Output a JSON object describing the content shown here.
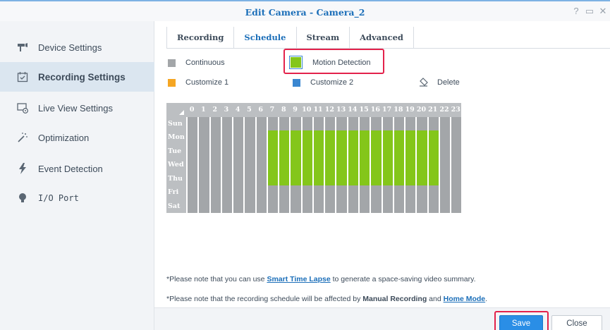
{
  "window": {
    "title": "Edit Camera - Camera_2",
    "controls": [
      {
        "name": "help-icon",
        "glyph": "?"
      },
      {
        "name": "maximize-icon",
        "glyph": "▭"
      },
      {
        "name": "close-window-icon",
        "glyph": "✕"
      }
    ]
  },
  "sidebar": {
    "items": [
      {
        "label": "Device Settings",
        "icon": "camera-icon",
        "active": false
      },
      {
        "label": "Recording Settings",
        "icon": "calendar-icon",
        "active": true
      },
      {
        "label": "Live View Settings",
        "icon": "live-view-icon",
        "active": false
      },
      {
        "label": "Optimization",
        "icon": "magic-wand-icon",
        "active": false
      },
      {
        "label": "Event Detection",
        "icon": "lightning-icon",
        "active": false
      },
      {
        "label": "I/O Port",
        "icon": "lightbulb-icon",
        "active": false
      }
    ]
  },
  "tabs": [
    {
      "label": "Recording",
      "active": false
    },
    {
      "label": "Schedule",
      "active": true
    },
    {
      "label": "Stream",
      "active": false
    },
    {
      "label": "Advanced",
      "active": false
    }
  ],
  "legend": {
    "continuous": {
      "label": "Continuous",
      "color": "#a3a6a9"
    },
    "motion_detection": {
      "label": "Motion Detection",
      "color": "#84c61a",
      "selected": true
    },
    "customize1": {
      "label": "Customize 1",
      "color": "#f5a623"
    },
    "customize2": {
      "label": "Customize 2",
      "color": "#3a87d1"
    },
    "delete": {
      "label": "Delete",
      "icon": "eraser-icon"
    }
  },
  "schedule": {
    "hours": [
      "0",
      "1",
      "2",
      "3",
      "4",
      "5",
      "6",
      "7",
      "8",
      "9",
      "10",
      "11",
      "12",
      "13",
      "14",
      "15",
      "16",
      "17",
      "18",
      "19",
      "20",
      "21",
      "22",
      "23"
    ],
    "days": [
      {
        "label": "Sun",
        "md_hours": []
      },
      {
        "label": "Mon",
        "md_hours": [
          7,
          8,
          9,
          10,
          11,
          12,
          13,
          14,
          15,
          16,
          17,
          18,
          19,
          20,
          21
        ]
      },
      {
        "label": "Tue",
        "md_hours": [
          7,
          8,
          9,
          10,
          11,
          12,
          13,
          14,
          15,
          16,
          17,
          18,
          19,
          20,
          21
        ]
      },
      {
        "label": "Wed",
        "md_hours": [
          7,
          8,
          9,
          10,
          11,
          12,
          13,
          14,
          15,
          16,
          17,
          18,
          19,
          20,
          21
        ]
      },
      {
        "label": "Thu",
        "md_hours": [
          7,
          8,
          9,
          10,
          11,
          12,
          13,
          14,
          15,
          16,
          17,
          18,
          19,
          20,
          21
        ]
      },
      {
        "label": "Fri",
        "md_hours": []
      },
      {
        "label": "Sat",
        "md_hours": []
      }
    ]
  },
  "notes": {
    "note1": {
      "prefix": "*Please note that you can use ",
      "link": "Smart Time Lapse",
      "suffix": " to generate a space-saving video summary."
    },
    "note2": {
      "prefix": "*Please note that the recording schedule will be affected by ",
      "bold": "Manual Recording",
      "middle": " and ",
      "link": "Home Mode",
      "suffix": "."
    }
  },
  "footer": {
    "save_label": "Save",
    "close_label": "Close"
  }
}
